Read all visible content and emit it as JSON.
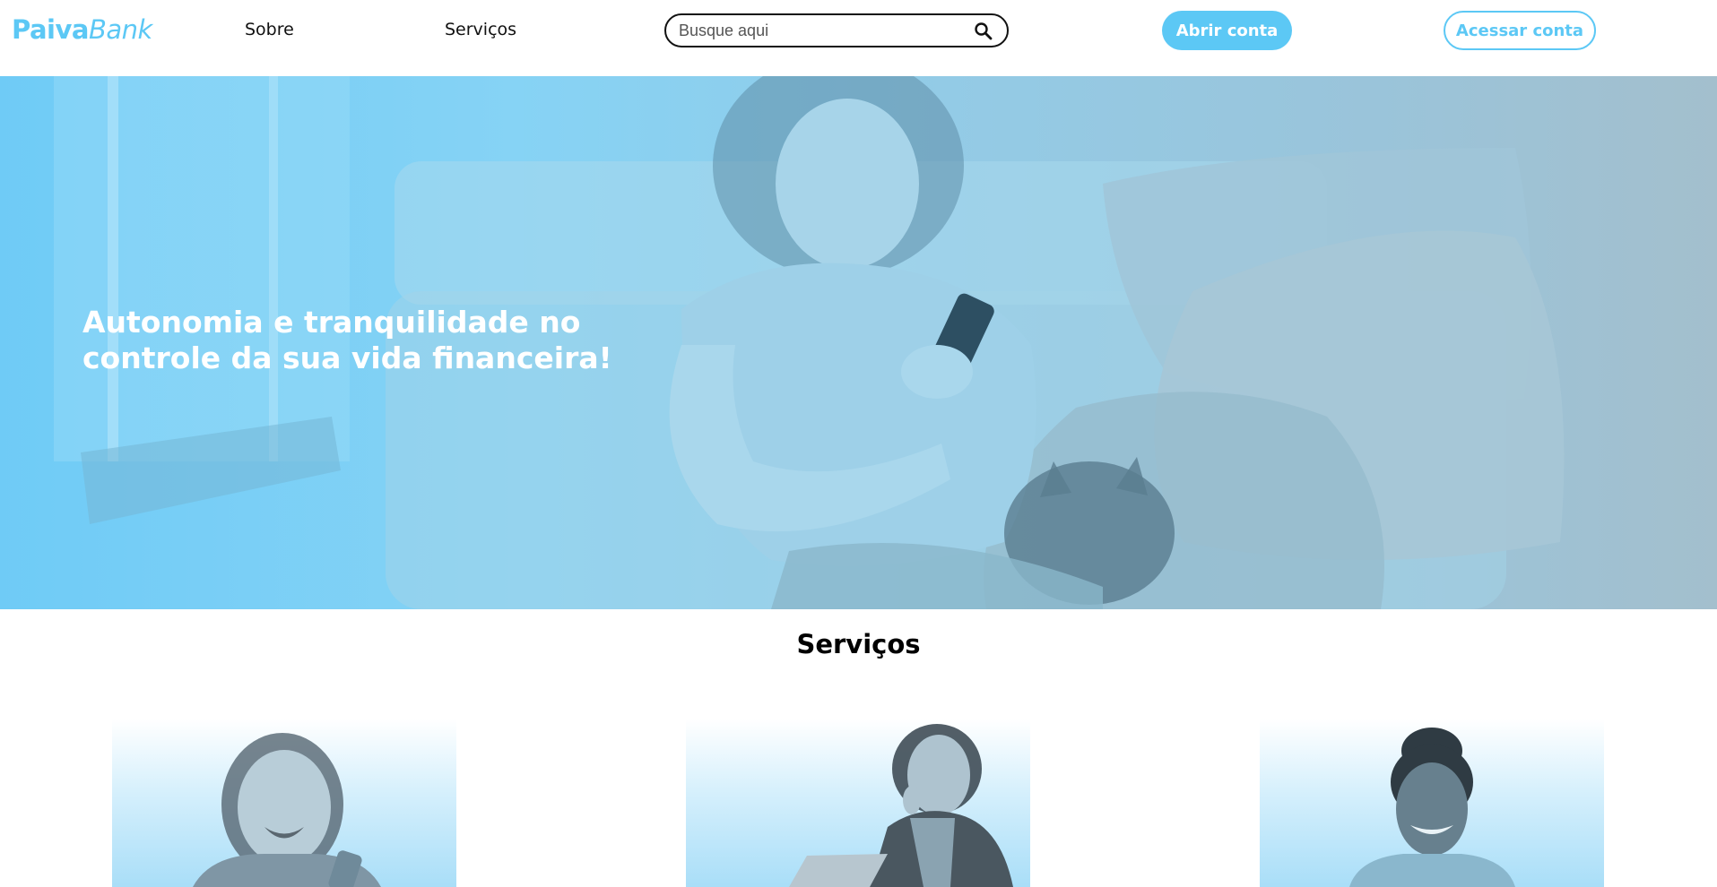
{
  "header": {
    "logo": {
      "part1": "Paiva",
      "part2": "Bank"
    },
    "nav": {
      "sobre": "Sobre",
      "servicos": "Serviços"
    },
    "search": {
      "placeholder": "Busque aqui",
      "value": ""
    },
    "open_account_label": "Abrir conta",
    "access_account_label": "Acessar conta"
  },
  "hero": {
    "title": "Autonomia e tranquilidade no controle da sua vida financeira!"
  },
  "services": {
    "title": "Serviços"
  },
  "colors": {
    "brand": "#5cc8f5",
    "hero_tint": "#86d3f5",
    "text": "#000000"
  },
  "icons": [
    "search-icon"
  ]
}
